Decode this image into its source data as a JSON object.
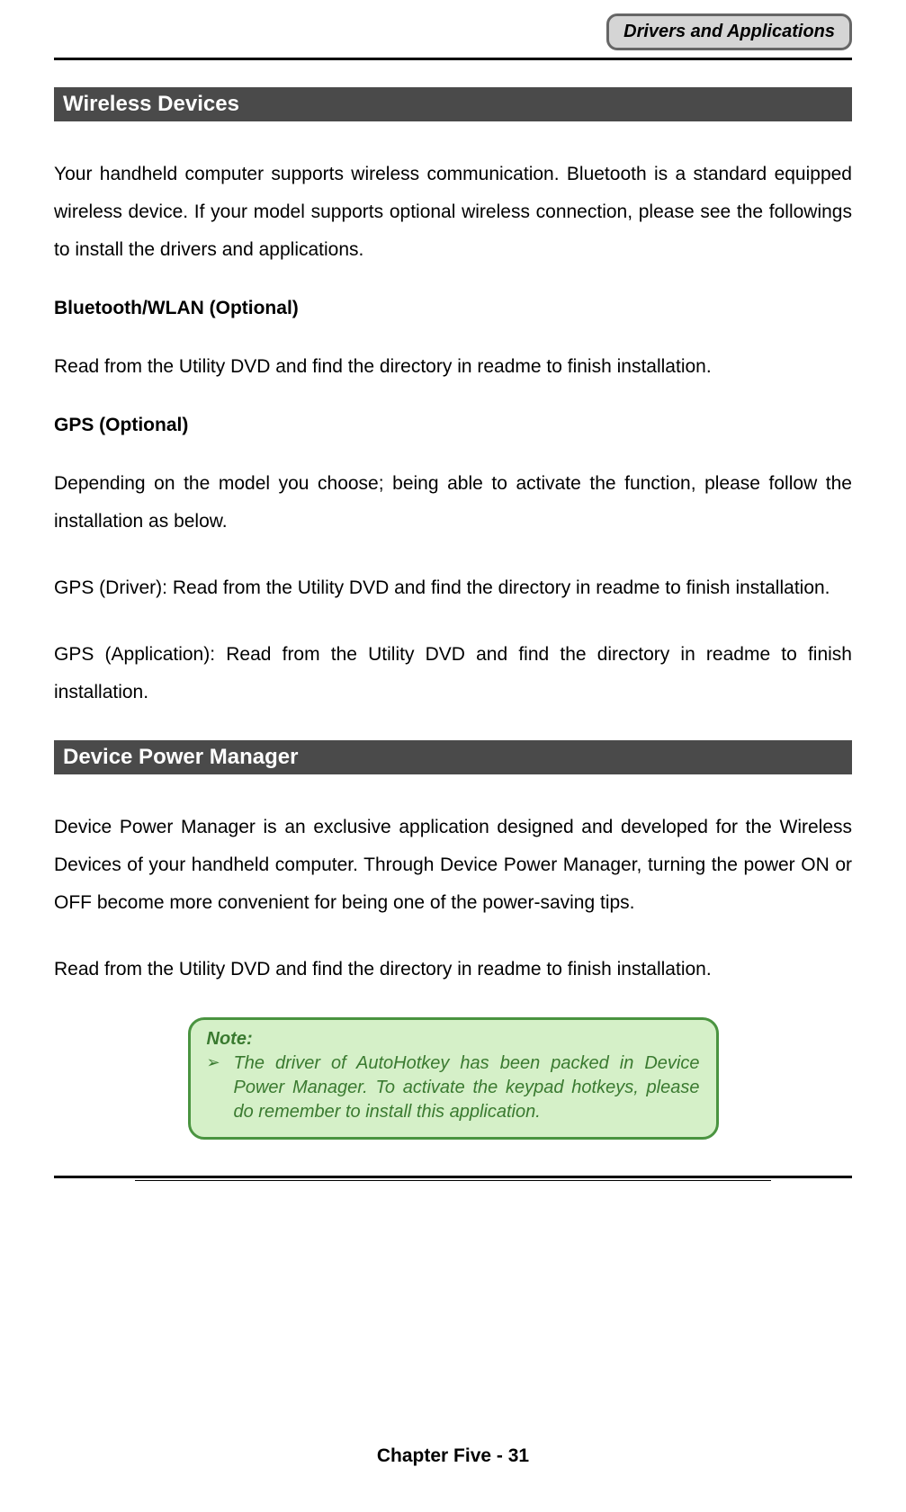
{
  "header": {
    "badge": "Drivers and Applications"
  },
  "section1": {
    "title": " Wireless Devices",
    "intro": "Your handheld computer supports wireless communication. Bluetooth is a standard equipped wireless device. If your model supports optional wireless connection, please see the followings to install the drivers and applications.",
    "sub1_title": "Bluetooth/WLAN (Optional)",
    "sub1_body": "Read from the Utility DVD and find the directory in readme to finish installation.",
    "sub2_title": "GPS (Optional)",
    "sub2_body1": "Depending on the model you choose; being able to activate the function, please follow the installation as below.",
    "sub2_body2": "GPS (Driver): Read from the Utility DVD and find the directory in readme to finish installation.",
    "sub2_body3": "GPS (Application): Read from the Utility DVD and find the directory in readme to finish installation."
  },
  "section2": {
    "title": " Device Power Manager",
    "body1": "Device Power Manager is an exclusive application designed and developed for the Wireless Devices of your handheld computer. Through Device Power Manager, turning the power ON or OFF become more convenient for being one of the power-saving tips.",
    "body2": "Read from the Utility DVD and find the directory in readme to finish installation."
  },
  "note": {
    "title": "Note:",
    "bullet": "➢",
    "text": "The driver of AutoHotkey has been packed in Device Power Manager. To activate the keypad hotkeys, please do remember to install this application."
  },
  "footer": "Chapter Five - 31"
}
